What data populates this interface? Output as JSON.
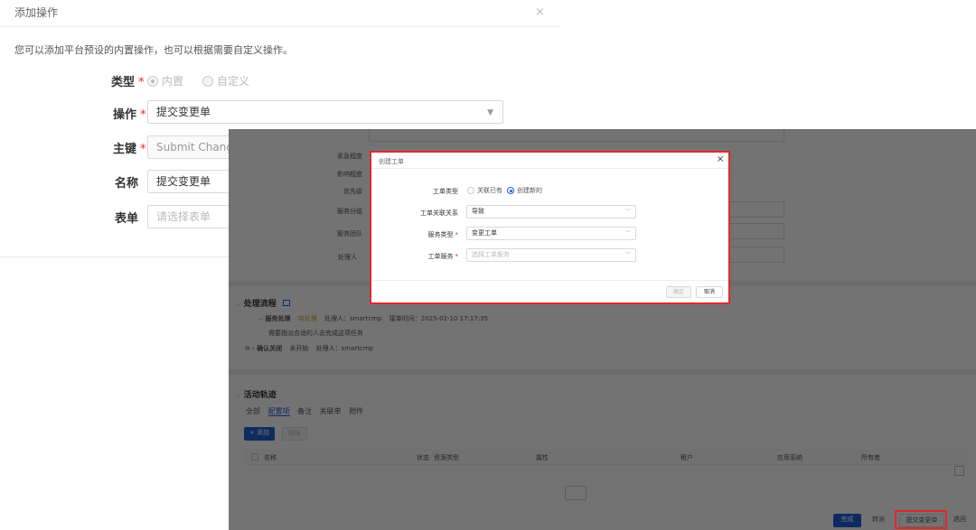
{
  "add_dialog": {
    "title": "添加操作",
    "close": "×",
    "description": "您可以添加平台预设的内置操作，也可以根据需要自定义操作。",
    "type_label": "类型",
    "type_options": [
      "内置",
      "自定义"
    ],
    "operation_label": "操作",
    "operation_value": "提交变更单",
    "key_label": "主键",
    "key_value": "Submit Change T",
    "name_label": "名称",
    "name_value": "提交变更单",
    "form_label": "表单",
    "form_placeholder": "请选择表单",
    "required_mark": "*"
  },
  "detail": {
    "fields": [
      "紧急程度",
      "影响程度",
      "优先级",
      "服务分组",
      "服务团队",
      "处理人"
    ],
    "process": {
      "title": "处理流程",
      "step1_name": "服务处理",
      "step1_status": "待处理",
      "step1_handler": "处理人：smartcmp",
      "step1_time": "接单时间：2025-02-10 17:17:35",
      "step1_desc": "需要指派合适的人去完成这项任务",
      "step2_name": "确认关闭",
      "step2_status": "未开始",
      "step2_handler": "处理人：smartcmp"
    },
    "activity": {
      "title": "活动轨迹",
      "tabs": [
        "全部",
        "配置项",
        "备注",
        "关联单",
        "附件"
      ],
      "add_btn": "+ 添加",
      "remove_btn": "移除",
      "columns": [
        "名称",
        "状态",
        "资源类型",
        "属性",
        "租户",
        "应用系统",
        "所有者"
      ]
    },
    "bottom_buttons": [
      "完成",
      "转派",
      "提交变更单",
      "退回"
    ]
  },
  "ticket_dialog": {
    "title": "创建工单",
    "close": "×",
    "type_label": "工单类型",
    "type_options": [
      "关联已有",
      "创建新的"
    ],
    "relation_label": "工单关联关系",
    "relation_value": "导致",
    "service_type_label": "服务类型",
    "service_type_value": "变更工单",
    "service_label": "工单服务",
    "service_placeholder": "选择工单服务",
    "confirm_btn": "确定",
    "cancel_btn": "取消",
    "required_mark": "*"
  },
  "colors": {
    "primary": "#1f5fd8",
    "highlight": "#e0282c",
    "required": "#f5222d"
  }
}
